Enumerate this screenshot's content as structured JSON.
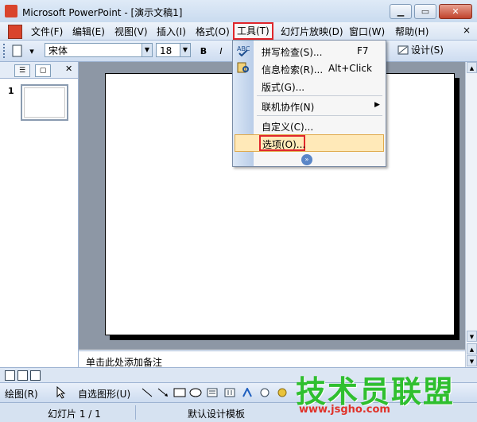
{
  "window": {
    "title": "Microsoft PowerPoint - [演示文稿1]",
    "controls": [
      "minimize",
      "restore",
      "close"
    ]
  },
  "menubar": {
    "items": [
      {
        "label": "文件(F)"
      },
      {
        "label": "编辑(E)"
      },
      {
        "label": "视图(V)"
      },
      {
        "label": "插入(I)"
      },
      {
        "label": "格式(O)"
      },
      {
        "label": "工具(T)",
        "active": true
      },
      {
        "label": "幻灯片放映(D)"
      },
      {
        "label": "窗口(W)"
      },
      {
        "label": "帮助(H)"
      }
    ],
    "close_label": "×"
  },
  "toolbar": {
    "font": "宋体",
    "size": "18",
    "bold": "B",
    "italic": "I",
    "design_label": "设计(S)"
  },
  "tools_menu": {
    "items": [
      {
        "label": "拼写检查(S)...",
        "shortcut": "F7"
      },
      {
        "label": "信息检索(R)...",
        "shortcut": "Alt+Click"
      },
      {
        "label": "版式(G)..."
      },
      {
        "label": "联机协作(N)",
        "submenu": true
      },
      {
        "label": "自定义(C)..."
      },
      {
        "label": "选项(O)...",
        "highlighted": true
      }
    ]
  },
  "slides_pane": {
    "slide_number": "1"
  },
  "notes": {
    "placeholder": "单击此处添加备注"
  },
  "drawbar": {
    "draw_label": "绘图(R)",
    "autoshapes_label": "自选图形(U)"
  },
  "statusbar": {
    "slide_info": "幻灯片 1 / 1",
    "template": "默认设计模板"
  },
  "watermark": {
    "brand": "技术员联盟",
    "url": "www.jsgho.com"
  },
  "colors": {
    "highlight_outline": "#e0262b",
    "menu_highlight": "#ffe9b8",
    "watermark_green": "#2fbf2f"
  }
}
